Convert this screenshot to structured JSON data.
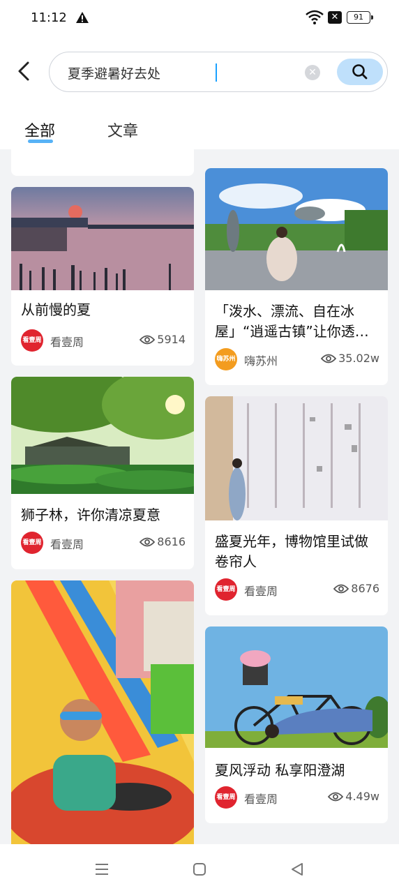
{
  "status": {
    "time": "11:12",
    "battery": "91"
  },
  "search": {
    "value": "夏季避暑好去处",
    "clear_icon": "clear-icon",
    "button_icon": "search-icon"
  },
  "tabs": [
    {
      "label": "全部",
      "active": true
    },
    {
      "label": "文章",
      "active": false
    }
  ],
  "cards": [
    {
      "title": "从前慢的夏",
      "author": "看壹周",
      "views": "5914"
    },
    {
      "title": "「泼水、漂流、自在冰屋」“逍遥古镇”让你透…",
      "author": "嗨苏州",
      "views": "35.02w"
    },
    {
      "title": "狮子林，许你清凉夏意",
      "author": "看壹周",
      "views": "8616"
    },
    {
      "title": "盛夏光年，博物馆里试做卷帘人",
      "author": "看壹周",
      "views": "8676"
    },
    {
      "title": "夏风浮动 私享阳澄湖",
      "author": "看壹周",
      "views": "4.49w"
    }
  ],
  "colors": {
    "accent": "#3aa4f5",
    "search_button": "#bfe0fb",
    "badge_red": "#e0242f",
    "badge_orange": "#f39c1f"
  }
}
